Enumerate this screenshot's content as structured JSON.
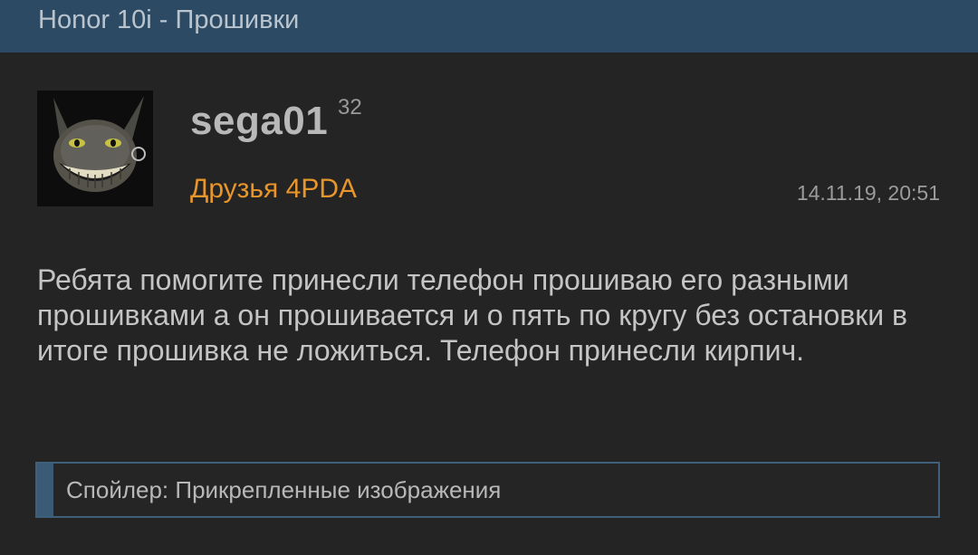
{
  "header": {
    "title": "Honor 10i - Прошивки"
  },
  "post": {
    "avatar_icon": "grinning-cat-avatar",
    "username": "sega01",
    "reputation": "32",
    "group": "Друзья 4PDA",
    "timestamp": "14.11.19, 20:51",
    "body": "Ребята помогите принесли телефон прошиваю его разными прошивками а он прошивается и о пять по кругу без остановки в итоге прошивка не ложиться. Телефон принесли кирпич.",
    "spoiler_label": "Спойлер: Прикрепленные изображения"
  },
  "colors": {
    "header_bg": "#2c4a63",
    "page_bg": "#242424",
    "group_accent": "#e8952a",
    "spoiler_border": "#3f5f7a"
  }
}
